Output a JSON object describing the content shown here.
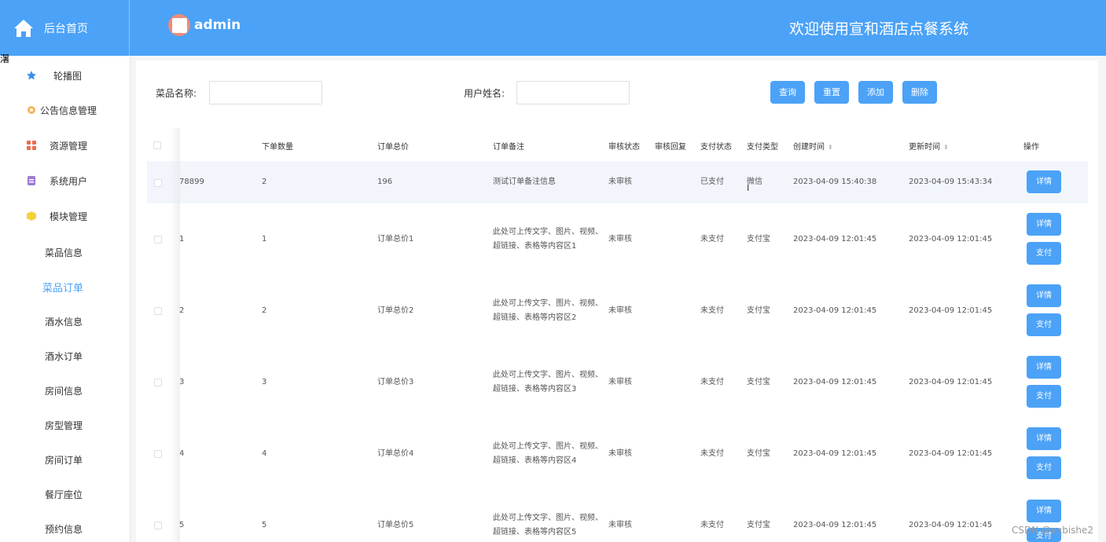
{
  "header": {
    "brand": "后台首页",
    "username": "admin",
    "welcome": "欢迎使用宣和酒店点餐系统"
  },
  "stray_text": "濐",
  "sidebar": {
    "menu": [
      {
        "label": "轮播图",
        "icon": "star-icon",
        "color": "#3b8ff0"
      },
      {
        "label": "公告信息管理",
        "icon": "gear-icon",
        "color": "#f5b556"
      },
      {
        "label": "资源管理",
        "icon": "grid-icon",
        "color": "#ef6b4e"
      },
      {
        "label": "系统用户",
        "icon": "database-icon",
        "color": "#9c7ad6"
      },
      {
        "label": "模块管理",
        "icon": "cube-icon",
        "color": "#f5d23a"
      }
    ],
    "submenu": [
      "菜品信息",
      "菜品订单",
      "酒水信息",
      "酒水订单",
      "房间信息",
      "房型管理",
      "房间订单",
      "餐厅座位",
      "预约信息"
    ],
    "active_sub": "菜品订单"
  },
  "search": {
    "dish_label": "菜品名称:",
    "dish_value": "",
    "user_label": "用户姓名:",
    "user_value": ""
  },
  "buttons": {
    "query": "查询",
    "reset": "重置",
    "add": "添加",
    "delete": "删除"
  },
  "table": {
    "headers": {
      "qty": "下单数量",
      "total": "订单总价",
      "remark": "订单备注",
      "audit_status": "审核状态",
      "audit_reply": "审核回复",
      "pay_status": "支付状态",
      "pay_type": "支付类型",
      "created": "创建时间",
      "updated": "更新时间",
      "action": "操作"
    },
    "rows": [
      {
        "id": "78899",
        "qty": "2",
        "total": "196",
        "remark": "测试订单备注信息",
        "audit_status": "未审核",
        "audit_reply": "",
        "pay_status": "已支付",
        "pay_type": "微信",
        "created": "2023-04-09 15:40:38",
        "updated": "2023-04-09 15:43:34",
        "actions": [
          "详情"
        ]
      },
      {
        "id": "1",
        "qty": "1",
        "total": "订单总价1",
        "remark": "此处可上传文字、图片、视频、超链接、表格等内容区1",
        "audit_status": "未审核",
        "audit_reply": "",
        "pay_status": "未支付",
        "pay_type": "支付宝",
        "created": "2023-04-09 12:01:45",
        "updated": "2023-04-09 12:01:45",
        "actions": [
          "详情",
          "支付"
        ]
      },
      {
        "id": "2",
        "qty": "2",
        "total": "订单总价2",
        "remark": "此处可上传文字、图片、视频、超链接、表格等内容区2",
        "audit_status": "未审核",
        "audit_reply": "",
        "pay_status": "未支付",
        "pay_type": "支付宝",
        "created": "2023-04-09 12:01:45",
        "updated": "2023-04-09 12:01:45",
        "actions": [
          "详情",
          "支付"
        ]
      },
      {
        "id": "3",
        "qty": "3",
        "total": "订单总价3",
        "remark": "此处可上传文字、图片、视频、超链接、表格等内容区3",
        "audit_status": "未审核",
        "audit_reply": "",
        "pay_status": "未支付",
        "pay_type": "支付宝",
        "created": "2023-04-09 12:01:45",
        "updated": "2023-04-09 12:01:45",
        "actions": [
          "详情",
          "支付"
        ]
      },
      {
        "id": "4",
        "qty": "4",
        "total": "订单总价4",
        "remark": "此处可上传文字、图片、视频、超链接、表格等内容区4",
        "audit_status": "未审核",
        "audit_reply": "",
        "pay_status": "未支付",
        "pay_type": "支付宝",
        "created": "2023-04-09 12:01:45",
        "updated": "2023-04-09 12:01:45",
        "actions": [
          "详情",
          "支付"
        ]
      },
      {
        "id": "5",
        "qty": "5",
        "total": "订单总价5",
        "remark": "此处可上传文字、图片、视频、超链接、表格等内容区5",
        "audit_status": "未审核",
        "audit_reply": "",
        "pay_status": "未支付",
        "pay_type": "支付宝",
        "created": "2023-04-09 12:01:45",
        "updated": "2023-04-09 12:01:45",
        "actions": [
          "详情",
          "支付"
        ]
      }
    ]
  },
  "watermark": "CSDN @vxbishe2"
}
